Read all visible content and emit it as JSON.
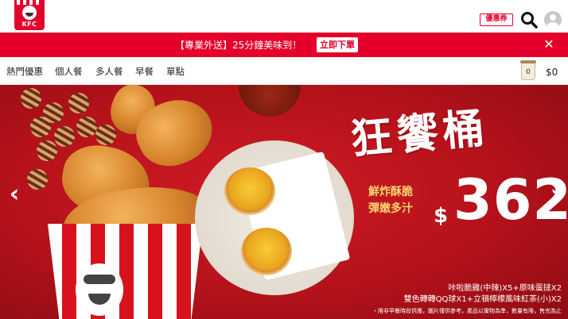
{
  "header": {
    "logo_text": "KFC",
    "coupon_label": "優惠券"
  },
  "promo": {
    "text": "【專業外送】25分鐘美味到！",
    "button_label": "立即下單",
    "close_symbol": "✕"
  },
  "nav": {
    "items": [
      "熱門優惠",
      "個人餐",
      "多人餐",
      "早餐",
      "單點"
    ],
    "cart_count": "0",
    "cart_total": "$0"
  },
  "hero": {
    "title": "狂饗桶",
    "slogan_line1": "鮮炸酥脆",
    "slogan_line2": "彈嫩多汁",
    "currency": "$",
    "price": "362",
    "desc_line1": "咔啦脆雞(中辣)X5+原味蛋撻X2",
    "desc_line2": "雙色轉轉QQ球X1+立頓檸檬風味紅茶(小)X2",
    "note": "・限非早餐時段供應，圖片僅供參考，產品以實物為準，數量有限，售完為止",
    "prev_arrow": "‹",
    "next_arrow": "›"
  },
  "colors": {
    "brand_red": "#e4002b",
    "hero_red": "#b5121b",
    "gold": "#f3d56b"
  }
}
